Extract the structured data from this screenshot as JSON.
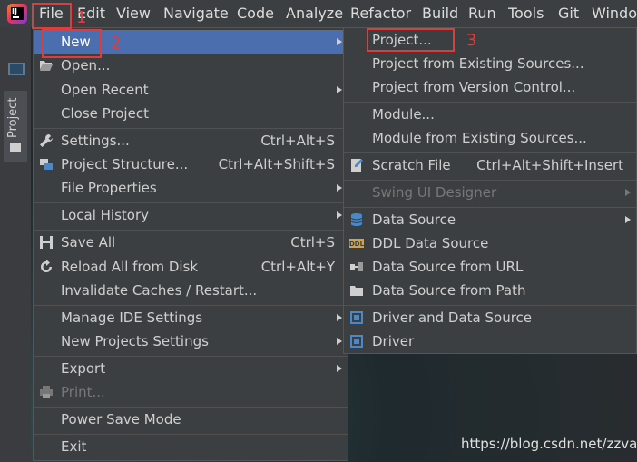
{
  "menubar": {
    "items": [
      "File",
      "Edit",
      "View",
      "Navigate",
      "Code",
      "Analyze",
      "Refactor",
      "Build",
      "Run",
      "Tools",
      "Git",
      "Windo"
    ]
  },
  "toolwindow": {
    "project_tab": "Project"
  },
  "file_menu": {
    "items": [
      {
        "label": "New"
      },
      {
        "label": "Open..."
      },
      {
        "label": "Open Recent"
      },
      {
        "label": "Close Project"
      },
      {
        "label": "Settings...",
        "shortcut": "Ctrl+Alt+S"
      },
      {
        "label": "Project Structure...",
        "shortcut": "Ctrl+Alt+Shift+S"
      },
      {
        "label": "File Properties"
      },
      {
        "label": "Local History"
      },
      {
        "label": "Save All",
        "shortcut": "Ctrl+S"
      },
      {
        "label": "Reload All from Disk",
        "shortcut": "Ctrl+Alt+Y"
      },
      {
        "label": "Invalidate Caches / Restart..."
      },
      {
        "label": "Manage IDE Settings"
      },
      {
        "label": "New Projects Settings"
      },
      {
        "label": "Export"
      },
      {
        "label": "Print..."
      },
      {
        "label": "Power Save Mode"
      },
      {
        "label": "Exit"
      }
    ]
  },
  "new_submenu": {
    "items": [
      {
        "label": "Project..."
      },
      {
        "label": "Project from Existing Sources..."
      },
      {
        "label": "Project from Version Control..."
      },
      {
        "label": "Module..."
      },
      {
        "label": "Module from Existing Sources..."
      },
      {
        "label": "Scratch File",
        "shortcut": "Ctrl+Alt+Shift+Insert"
      },
      {
        "label": "Swing UI Designer"
      },
      {
        "label": "Data Source"
      },
      {
        "label": "DDL Data Source"
      },
      {
        "label": "Data Source from URL"
      },
      {
        "label": "Data Source from Path"
      },
      {
        "label": "Driver and Data Source"
      },
      {
        "label": "Driver"
      }
    ]
  },
  "annotations": [
    "1",
    "2",
    "3"
  ],
  "icons": {
    "ddl": "DDL"
  },
  "watermark": "https://blog.csdn.net/zzvar",
  "colors": {
    "menu_bg": "#3c3f41",
    "highlight": "#4b6eaf",
    "annotation": "#e23b3b"
  }
}
